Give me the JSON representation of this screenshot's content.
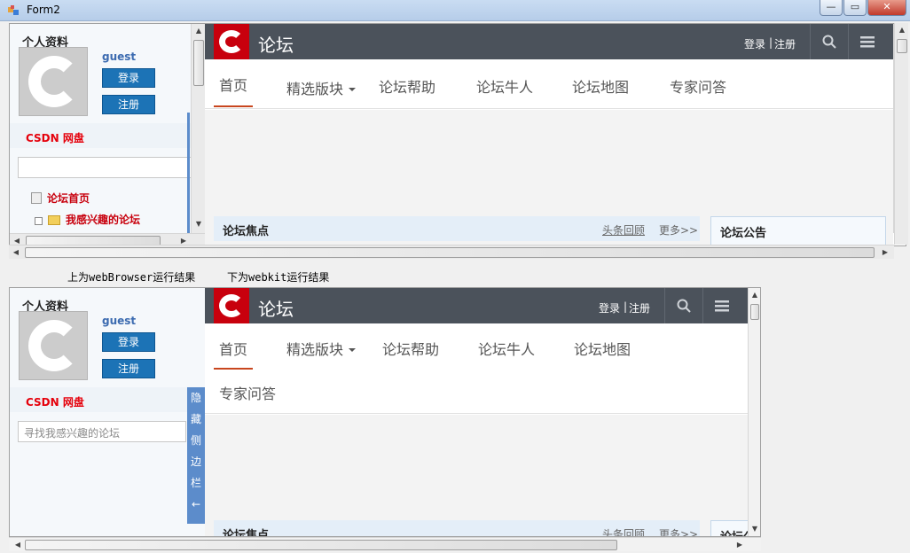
{
  "window": {
    "title": "Form2",
    "min": "—",
    "max": "▭",
    "close": "✕"
  },
  "sidebar": {
    "profile_title": "个人资料",
    "username": "guest",
    "login": "登录",
    "register": "注册",
    "netdisk": "CSDN 网盘",
    "search_placeholder": "寻找我感兴趣的论坛",
    "tree": [
      "论坛首页",
      "我感兴趣的论坛"
    ],
    "hide_tab": [
      "隐",
      "藏",
      "侧",
      "边",
      "栏",
      "←"
    ]
  },
  "header": {
    "title": "论坛",
    "login": "登录",
    "sep": "|",
    "register": "注册"
  },
  "nav": {
    "items": [
      "首页",
      "精选版块",
      "论坛帮助",
      "论坛牛人",
      "论坛地图",
      "专家问答"
    ]
  },
  "focus": {
    "title": "论坛焦点",
    "headline_review": "头条回顾",
    "more": "更多>>"
  },
  "notice": {
    "title": "论坛公告"
  },
  "captions": {
    "top": "上为webBrowser运行结果",
    "bottom": "下为webkit运行结果"
  },
  "colors": {
    "brand_red": "#c8000d",
    "header_bg": "#4b525b",
    "button_blue": "#1c73b6",
    "accent_orange": "#c8461e"
  }
}
